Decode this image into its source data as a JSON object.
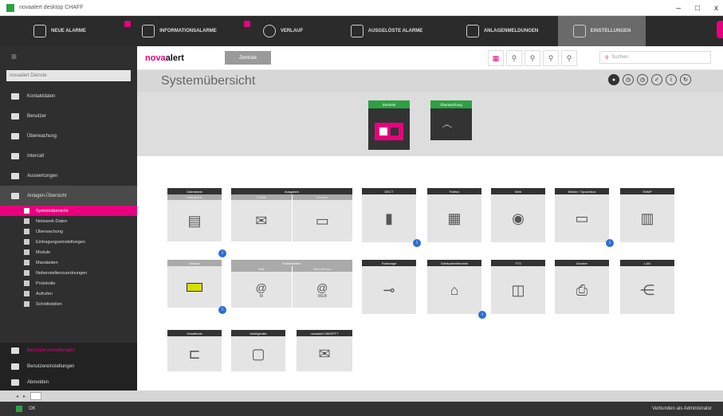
{
  "window": {
    "title": "novaalert desktop CHAFF",
    "min": "–",
    "max": "□",
    "close": "x"
  },
  "topnav": [
    {
      "label": "Neue Alarme",
      "active": false
    },
    {
      "label": "Informationsalarme",
      "active": false
    },
    {
      "label": "Verlauf",
      "active": false
    },
    {
      "label": "Ausgelöste Alarme",
      "active": false
    },
    {
      "label": "Anlagenmeldungen",
      "active": false
    },
    {
      "label": "Einstellungen",
      "active": true
    }
  ],
  "sidebar": {
    "search_placeholder": "novaalert Dienste",
    "items": [
      {
        "label": "Kontaktdaten",
        "icon": "contact-icon"
      },
      {
        "label": "Benutzer",
        "icon": "users-icon"
      },
      {
        "label": "Überwachung",
        "icon": "eye-icon"
      },
      {
        "label": "Intercall",
        "icon": "phone-icon"
      },
      {
        "label": "Auswertungen",
        "icon": "chart-icon"
      },
      {
        "label": "Anlagen-Übersicht",
        "icon": "building-icon"
      }
    ],
    "subitems": [
      {
        "label": "Systemübersicht",
        "active": true
      },
      {
        "label": "Netzwerk-Daten",
        "active": false
      },
      {
        "label": "Überwachung",
        "active": false
      },
      {
        "label": "Eintragungseinstellungen",
        "active": false
      },
      {
        "label": "Module",
        "active": false
      },
      {
        "label": "Mandanten",
        "active": false
      },
      {
        "label": "Nebenstellenzuordnungen",
        "active": false
      },
      {
        "label": "Protokolle",
        "active": false
      },
      {
        "label": "Aufrufen",
        "active": false
      },
      {
        "label": "Schnittstellen",
        "active": false
      }
    ],
    "bottom": [
      {
        "label": "Benutzerverwaltungen",
        "pink": true
      },
      {
        "label": "Benutzereinstellungen",
        "pink": false
      },
      {
        "label": "Abmelden",
        "pink": false
      }
    ]
  },
  "header": {
    "logo_prefix": "nova",
    "logo_suffix": "alert",
    "button": "Zentrale",
    "search_placeholder": "Suchen"
  },
  "page": {
    "title": "Systemübersicht"
  },
  "status": [
    {
      "label": "Zentrale"
    },
    {
      "label": "Überwachung"
    }
  ],
  "tiles": [
    {
      "title": "Datenbank",
      "subs": [
        "Datenbank"
      ],
      "glyph": "▤"
    },
    {
      "title": "Ausgaben",
      "subs": [
        "E-Mail",
        "Drucker"
      ],
      "glyph2": [
        "✉",
        "▭"
      ]
    },
    {
      "title": "DECT",
      "glyph": "▮"
    },
    {
      "title": "Telefon",
      "glyph": "▦"
    },
    {
      "title": "Web",
      "glyph": "◉"
    },
    {
      "title": "Melder / Sprachbox",
      "glyph": "▭"
    },
    {
      "title": "SNMP",
      "glyph": "▥"
    },
    {
      "title": "Module",
      "glyph": "▬"
    },
    {
      "title": "Schnittstellen",
      "subs": [
        "Mail",
        "Web-Service"
      ],
      "glyph2": [
        "@",
        "@"
      ],
      "caption2": [
        "M",
        "WEB"
      ]
    },
    {
      "title": "Rufanlage",
      "glyph": "⊸"
    },
    {
      "title": "Gebäudeleittechnik",
      "glyph": "⌂"
    },
    {
      "title": "TTS",
      "glyph": "◫"
    },
    {
      "title": "Drucker",
      "glyph": "⎙"
    },
    {
      "title": "LAN",
      "glyph": "⋲"
    },
    {
      "title": "Schaltkreis",
      "glyph": "⊏"
    },
    {
      "title": "Mobilgeräte",
      "glyph": "▢"
    },
    {
      "title": "novaalert SMS/PTT",
      "glyph": "✉"
    }
  ],
  "bottombar": {
    "status": "OK",
    "right": "Verbunden als Administrator"
  }
}
